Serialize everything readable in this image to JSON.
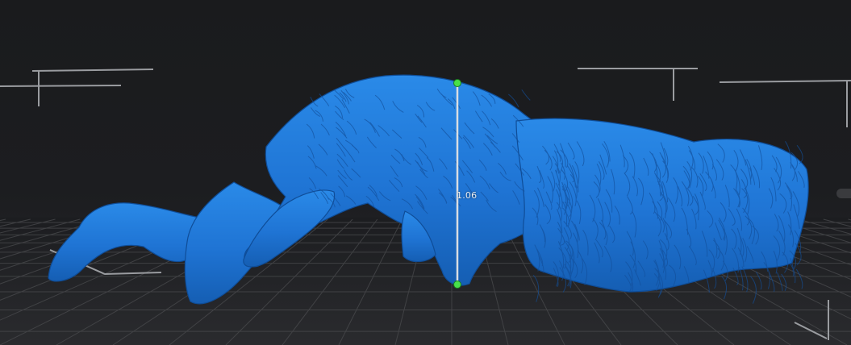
{
  "measurement": {
    "label": "1.06"
  },
  "colors": {
    "background": "#1b1c1e",
    "grid_line": "#4a4b4e",
    "model": "#1f74d4",
    "measure_line": "#d9dde2",
    "measure_point": "#48e04a"
  },
  "icons": {
    "measure_start_point": "green-dot",
    "measure_end_point": "green-dot"
  }
}
